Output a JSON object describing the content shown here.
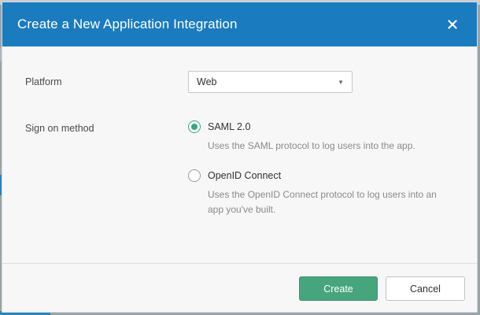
{
  "dialog": {
    "title": "Create a New Application Integration",
    "close_icon": "close-icon"
  },
  "platform": {
    "label": "Platform",
    "selected": "Web",
    "dropdown_icon": "caret-down-icon"
  },
  "sign_on": {
    "label": "Sign on method",
    "options": [
      {
        "label": "SAML 2.0",
        "description": "Uses the SAML protocol to log users into the app.",
        "checked": true
      },
      {
        "label": "OpenID Connect",
        "description": "Uses the OpenID Connect protocol to log users into an app you've built.",
        "checked": false
      }
    ]
  },
  "footer": {
    "create_label": "Create",
    "cancel_label": "Cancel"
  },
  "colors": {
    "header": "#1a7bbf",
    "primary_button": "#46a57d",
    "radio_checked": "#3aa67c"
  }
}
